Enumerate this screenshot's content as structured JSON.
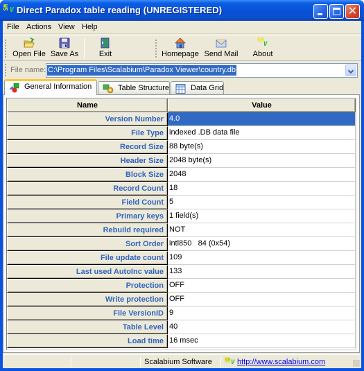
{
  "window": {
    "title": "Direct Paradox table reading (UNREGISTERED)",
    "app_icon": "sm-v-logo-icon",
    "controls": [
      "minimize",
      "maximize",
      "close"
    ]
  },
  "menu": {
    "items": [
      {
        "label": "File"
      },
      {
        "label": "Actions"
      },
      {
        "label": "View"
      },
      {
        "label": "Help"
      }
    ]
  },
  "toolbar": {
    "left": [
      {
        "label": "Open File",
        "icon": "open-folder-icon"
      },
      {
        "label": "Save As",
        "icon": "floppy-disk-icon"
      },
      {
        "label": "Exit",
        "icon": "exit-door-icon"
      }
    ],
    "right": [
      {
        "label": "Homepage",
        "icon": "home-icon"
      },
      {
        "label": "Send Mail",
        "icon": "envelope-icon"
      },
      {
        "label": "About",
        "icon": "sm-v-logo-icon"
      }
    ]
  },
  "file_bar": {
    "label": "File name:",
    "value": "C:\\Program Files\\Scalabium\\Paradox Viewer\\country.db"
  },
  "tabs": [
    {
      "label": "General Information",
      "icon": "shapes-icon",
      "active": true
    },
    {
      "label": "Table Structure",
      "icon": "structure-gear-icon",
      "active": false
    },
    {
      "label": "Data Grid",
      "icon": "grid-icon",
      "active": false
    }
  ],
  "grid": {
    "columns": [
      "Name",
      "Value"
    ],
    "selected_row": 0,
    "rows": [
      {
        "name": "Version Number",
        "value": "4.0"
      },
      {
        "name": "File Type",
        "value": "indexed .DB data file"
      },
      {
        "name": "Record Size",
        "value": "88 byte(s)"
      },
      {
        "name": "Header Size",
        "value": "2048 byte(s)"
      },
      {
        "name": "Block Size",
        "value": "2048"
      },
      {
        "name": "Record Count",
        "value": "18"
      },
      {
        "name": "Field Count",
        "value": "5"
      },
      {
        "name": "Primary keys",
        "value": "1 field(s)"
      },
      {
        "name": "Rebuild required",
        "value": "NOT"
      },
      {
        "name": "Sort Order",
        "value": "intl850   84 (0x54)"
      },
      {
        "name": "File update count",
        "value": "109"
      },
      {
        "name": "Last used AutoInc value",
        "value": "133"
      },
      {
        "name": "Protection",
        "value": "OFF"
      },
      {
        "name": "Write protection",
        "value": "OFF"
      },
      {
        "name": "File VersionID",
        "value": "9"
      },
      {
        "name": "Table Level",
        "value": "40"
      },
      {
        "name": "Load time",
        "value": "16 msec"
      }
    ]
  },
  "status_bar": {
    "company": "Scalabium Software",
    "link": "http://www.scalabium.com"
  },
  "colors": {
    "titlebar": "#0a53e0",
    "selection": "#316ac5",
    "name_text": "#3064c0",
    "face": "#ece9d8",
    "active_tab_accent": "#ffc83c"
  }
}
